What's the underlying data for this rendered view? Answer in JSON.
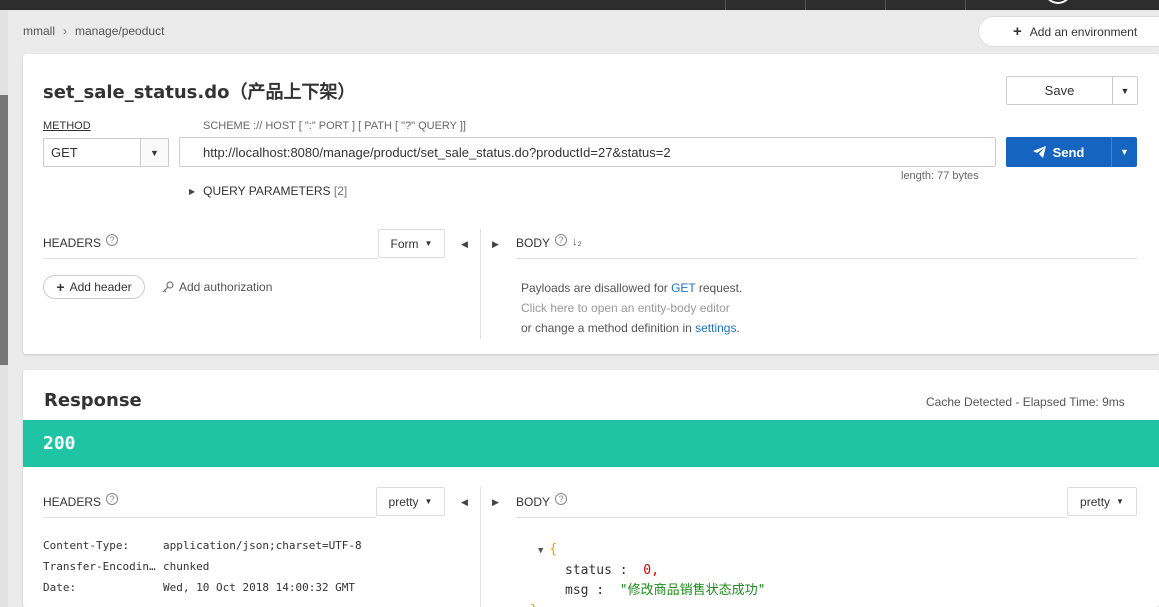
{
  "breadcrumb": {
    "root": "mmall",
    "path": "manage/peoduct"
  },
  "environment": {
    "add_label": "Add an environment"
  },
  "request": {
    "title": "set_sale_status.do（产品上下架）",
    "save_label": "Save",
    "method_label": "METHOD",
    "method_value": "GET",
    "scheme_label": "SCHEME :// HOST [ \":\" PORT ] [ PATH [ \"?\" QUERY ]]",
    "url": "http://localhost:8080/manage/product/set_sale_status.do?productId=27&status=2",
    "send_label": "Send",
    "length_label": "length: 77 bytes",
    "query_params_label": "QUERY PARAMETERS",
    "query_params_count": "[2]",
    "headers_label": "HEADERS",
    "headers_mode": "Form",
    "body_label": "BODY",
    "add_header_label": "Add header",
    "add_auth_label": "Add authorization",
    "body_msg": {
      "line1_pre": "Payloads are disallowed for ",
      "line1_method": "GET",
      "line1_post": " request.",
      "line2": "Click here to open an entity-body editor",
      "line3_pre": "or change a method definition in ",
      "line3_link": "settings",
      "line3_post": "."
    }
  },
  "response": {
    "title": "Response",
    "cache_info": "Cache Detected - Elapsed Time: 9ms",
    "status_code": "200",
    "status_color": "#1ec4a4",
    "headers_label": "HEADERS",
    "headers_mode": "pretty",
    "body_label": "BODY",
    "body_mode": "pretty",
    "headers": [
      {
        "key": "Content-Type:",
        "value": "application/json;charset=UTF-8"
      },
      {
        "key": "Transfer-Encodin…",
        "value": "chunked"
      },
      {
        "key": "Date:",
        "value": "Wed, 10 Oct 2018 14:00:32 GMT"
      }
    ],
    "body": {
      "open": "{",
      "status_key": "status",
      "status_value": "0,",
      "msg_key": "msg",
      "msg_value": "\"修改商品销售状态成功\"",
      "close": "}"
    }
  },
  "colors": {
    "send": "#1565c0",
    "link": "#1a73c5"
  }
}
